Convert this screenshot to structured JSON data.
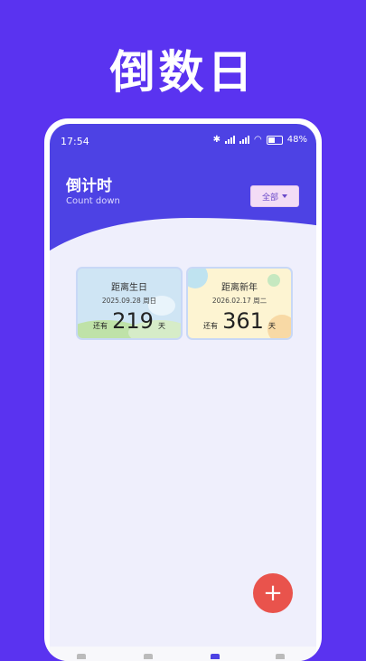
{
  "banner": {
    "title": "倒数日"
  },
  "status_bar": {
    "time": "17:54",
    "battery": "48"
  },
  "header": {
    "title": "倒计时",
    "subtitle": "Count down",
    "filter_label": "全部"
  },
  "cards": [
    {
      "name": "距离生日",
      "date": "2025.09.28 周日",
      "prefix": "还有",
      "days": "219",
      "unit": "天"
    },
    {
      "name": "距离新年",
      "date": "2026.02.17 周二",
      "prefix": "还有",
      "days": "361",
      "unit": "天"
    }
  ],
  "fab": {
    "label": "+"
  },
  "colors": {
    "background": "#5a33f0",
    "header": "#4d42e4",
    "fab": "#e9534c"
  }
}
